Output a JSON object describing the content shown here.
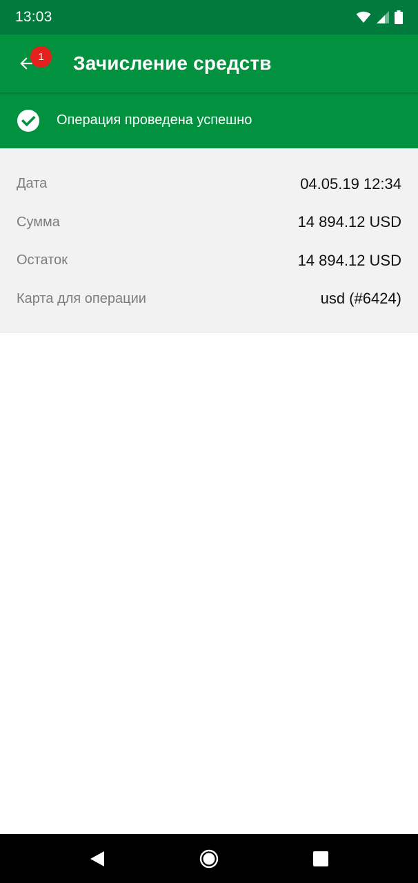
{
  "status_bar": {
    "time": "13:03",
    "icons": [
      "wifi-icon",
      "signal-icon",
      "battery-icon"
    ]
  },
  "app_bar": {
    "back_icon": "arrow-left-icon",
    "badge_count": "1",
    "title": "Зачисление средств"
  },
  "banner": {
    "icon": "check-circle-icon",
    "message": "Операция проведена успешно"
  },
  "details": [
    {
      "label": "Дата",
      "value": "04.05.19 12:34"
    },
    {
      "label": "Сумма",
      "value": "14 894.12 USD"
    },
    {
      "label": "Остаток",
      "value": "14 894.12 USD"
    },
    {
      "label": "Карта для операции",
      "value": "usd (#6424)"
    }
  ],
  "nav_bar": {
    "buttons": [
      "back-triangle-icon",
      "home-circle-icon",
      "recents-square-icon"
    ]
  },
  "colors": {
    "status_bar": "#007a3d",
    "primary_green": "#02923f",
    "badge_red": "#e3201b",
    "details_bg": "#f2f2f2"
  }
}
